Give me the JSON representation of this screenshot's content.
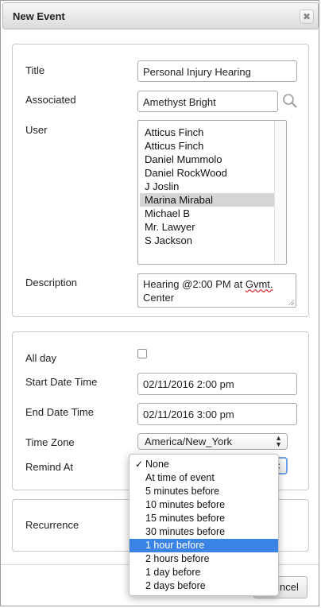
{
  "dialog": {
    "title": "New Event",
    "close_icon": "close-icon"
  },
  "details": {
    "title_label": "Title",
    "title_value": "Personal Injury Hearing",
    "associated_label": "Associated",
    "associated_value": "Amethyst Bright",
    "user_label": "User",
    "users": [
      "Atticus Finch",
      "Atticus Finch",
      "Daniel Mummolo",
      "Daniel RockWood",
      "J Joslin",
      "Marina Mirabal",
      "Michael B",
      "Mr. Lawyer",
      "S Jackson"
    ],
    "selected_user": "Marina Mirabal",
    "description_label": "Description",
    "description_line1_a": "Hearing @2:00 PM at ",
    "description_line1_b": "Gvmt.",
    "description_line2": "Center"
  },
  "timing": {
    "allday_label": "All day",
    "allday_checked": false,
    "start_label": "Start Date Time",
    "start_value": "02/11/2016 2:00 pm",
    "end_label": "End Date Time",
    "end_value": "02/11/2016 3:00 pm",
    "timezone_label": "Time Zone",
    "timezone_value": "America/New_York",
    "remind_label": "Remind At",
    "remind_options": [
      "None",
      "At time of event",
      "5 minutes before",
      "10 minutes before",
      "15 minutes before",
      "30 minutes before",
      "1 hour before",
      "2 hours before",
      "1 day before",
      "2 days before"
    ],
    "remind_checked": "None",
    "remind_highlighted": "1 hour before"
  },
  "recurrence": {
    "label": "Recurrence"
  },
  "footer": {
    "cancel_partial": "ncel"
  },
  "colors": {
    "highlight": "#3b83e4",
    "selected_row": "#d5d5d5",
    "focus_ring": "#6fa0e6"
  }
}
